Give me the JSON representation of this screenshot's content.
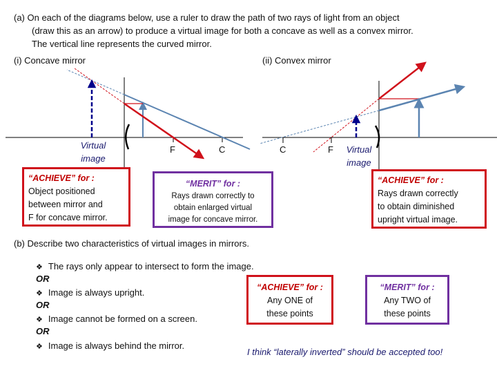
{
  "part_a": {
    "question_lines": [
      "(a)  On each of the diagrams below, use a ruler to draw the path of two rays of light from an object",
      "(draw this as an arrow) to produce a virtual image for both a concave as well as a convex mirror.",
      "The vertical line represents the curved mirror."
    ],
    "concave": {
      "heading": "(i)  Concave mirror",
      "label_f": "F",
      "label_c": "C",
      "virtual_image_label": [
        "Virtual",
        "image"
      ],
      "achieve_box": {
        "heading": "“ACHIEVE” for :",
        "lines": [
          "Object positioned",
          "between mirror and",
          "F for concave mirror."
        ]
      },
      "merit_box": {
        "heading": "“MERIT” for :",
        "lines": [
          "Rays drawn correctly to",
          "obtain enlarged virtual",
          "image for concave mirror."
        ]
      }
    },
    "convex": {
      "heading": "(ii)  Convex mirror",
      "label_c": "C",
      "label_f": "F",
      "virtual_image_label": [
        "Virtual",
        "image"
      ],
      "achieve_box": {
        "heading": "“ACHIEVE” for :",
        "lines": [
          "Rays drawn correctly",
          "to obtain diminished",
          "upright virtual image."
        ]
      }
    }
  },
  "part_b": {
    "question": "(b)  Describe two characteristics of virtual images in mirrors.",
    "points": [
      "The rays only appear to intersect to form the image.",
      "Image is always upright.",
      "Image cannot be formed on a screen.",
      "Image is always behind the mirror."
    ],
    "or_label": "OR",
    "achieve_box": {
      "heading": "“ACHIEVE” for :",
      "lines": [
        "Any ONE of",
        "these points"
      ]
    },
    "merit_box": {
      "heading": "“MERIT” for :",
      "lines": [
        "Any TWO of",
        "these points"
      ]
    },
    "note": "I think “laterally inverted” should be accepted too!"
  },
  "colors": {
    "achieve": "#d0111b",
    "merit": "#7030a0",
    "ray_blue": "#5b84b1",
    "ray_red": "#d0111b",
    "image_navy": "#00008b"
  }
}
